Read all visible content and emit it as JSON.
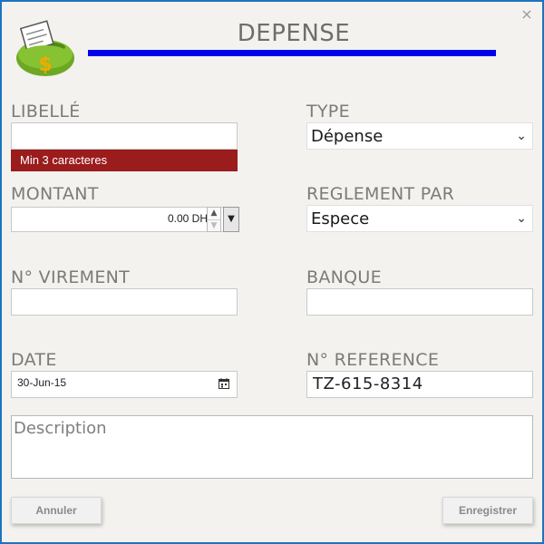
{
  "window": {
    "close_glyph": "×"
  },
  "header": {
    "title": "DEPENSE"
  },
  "form": {
    "libelle": {
      "label": "LIBELLÉ",
      "value": "",
      "error": "Min 3 caracteres"
    },
    "type": {
      "label": "TYPE",
      "value": "Dépense"
    },
    "montant": {
      "label": "MONTANT",
      "value": "0.00 DH"
    },
    "reglement": {
      "label": "REGLEMENT PAR",
      "value": "Espece"
    },
    "virement": {
      "label": "N° VIREMENT",
      "value": ""
    },
    "banque": {
      "label": "BANQUE",
      "value": ""
    },
    "date": {
      "label": "DATE",
      "value": "30-Jun-15"
    },
    "reference": {
      "label": "N° REFERENCE",
      "value": "TZ-615-8314"
    },
    "description": {
      "placeholder": "Description"
    }
  },
  "buttons": {
    "cancel": "Annuler",
    "save": "Enregistrer"
  },
  "colors": {
    "accent_bar": "#0000ee",
    "error_bg": "#9b1c1c",
    "window_border": "#1e73be"
  }
}
